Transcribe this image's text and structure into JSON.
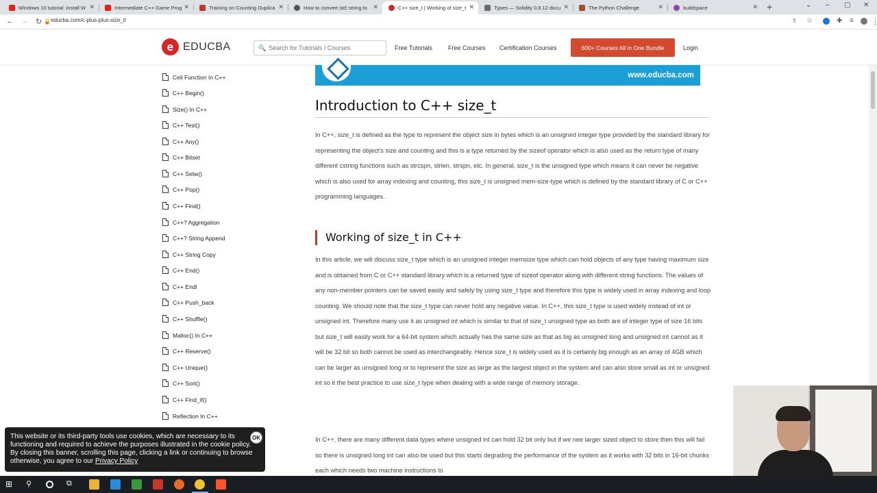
{
  "browser": {
    "tabs": [
      {
        "label": "Windows 10 tutorial: install W",
        "icon": "youtube-icon",
        "color": "#e62117"
      },
      {
        "label": "Intermediate C++ Game Prog",
        "icon": "youtube-icon",
        "color": "#e62117"
      },
      {
        "label": "Training on Counting Duplica",
        "icon": "geeks-icon",
        "color": "#c0392b"
      },
      {
        "label": "How to convert std::string to",
        "icon": "gear-icon",
        "color": "#555555"
      },
      {
        "label": "C++ size_t | Working of size_t",
        "icon": "educba-icon",
        "color": "#d52727",
        "active": true
      },
      {
        "label": "Types — Solidity 0.8.12 docu",
        "icon": "doc-icon",
        "color": "#6b6b6b"
      },
      {
        "label": "The Python Challenge",
        "icon": "python-icon",
        "color": "#a0522d"
      },
      {
        "label": "buildspace",
        "icon": "buildspace-icon",
        "color": "#8e44ad"
      }
    ],
    "url": "educba.com/c-plus-plus-size_t/"
  },
  "site": {
    "logo_text": "EDUCBA",
    "logo_mark": "e",
    "search_placeholder": "Search for Tutorials / Courses",
    "nav": [
      "Free Tutorials",
      "Free Courses",
      "Certification Courses"
    ],
    "bundle_label": "600+ Courses All in One Bundle",
    "login_label": "Login",
    "banner_site": "www.educba.com",
    "accent": "#d44a30"
  },
  "sidebar": {
    "items": [
      "Ceil Function In C++",
      "C++ Begin()",
      "Size() In C++",
      "C++ Test()",
      "C++ Any()",
      "C++ Bitset",
      "C++ Setw()",
      "C++ Pop()",
      "C++ Find()",
      "C++? Aggregation",
      "C++? String Append",
      "C++ String Copy",
      "C++ End()",
      "C++ Endl",
      "C++ Push_back",
      "C++ Shuffle()",
      "Malloc() In C++",
      "C++ Reserve()",
      "C++ Unique()",
      "C++ Sort()",
      "C++ Find_if()",
      "Reflection In C++"
    ]
  },
  "article": {
    "title": "Introduction to C++ size_t",
    "intro": "In C++, size_t is defined as the type to represent the object size in bytes which is an unsigned integer type provided by the standard library for representing the object's size and counting and this is a type returned by the sizeof operator which is also used as the return type of many different cstring functions such as strcspn, strlen, strspn, etc. In general, size_t is the unsigned type which means it can never be negative which is also used for array indexing and counting, this size_t is unsigned mem-size-type which is defined by the standard library of C or C++ programming languages.",
    "section_title": "Working of size_t in C++",
    "para1": "In this article, we will discuss size_t type which is an unsigned integer memsize type which can hold objects of any type having maximum size and is obtained from C or C++ standard library which is a returned type of sizeof operator along with different string functions. The values of any non-member pointers can be saved easily and safely by using size_t type and therefore this type is widely used in array indexing and loop counting. We should note that the size_t type can never hold any negative value. In C++, this size_t type is used widely instead of int or unsigned int. Therefore many use it as unsigned int which is similar to that of size_t unsigned type as both are of integer type of size 16 bits but size_t will easily work for a 64-bit system which actually has the same size as that as big as unsigned long and unsigned int cannot as it will be 32 bit so both cannot be used as interchangeably. Hence size_t is widely used as it is certainly big enough as an array of 4GB which can be larger as unsigned long or to represent the size as large as the largest object in the system and can also store small as int or unsigned int so it the best practice to use size_t type when dealing with a wide range of memory storage.",
    "para2": "In C++, there are many different data types where unsigned int can hold 32 bit only but if we nee larger sized object to store then this will fail so there is unsigned long int can also be used but this starts degrading the performance of the system as it works with 32 bits in 16-bit chunks each which needs two machine instructions to"
  },
  "cookie": {
    "text": "This website or its third-party tools use cookies, which are necessary to its functioning and required to achieve the purposes illustrated in the cookie policy. By closing this banner, scrolling this page, clicking a link or continuing to browse otherwise, you agree to our ",
    "link": "Privacy Policy",
    "ok_label": "OK"
  }
}
